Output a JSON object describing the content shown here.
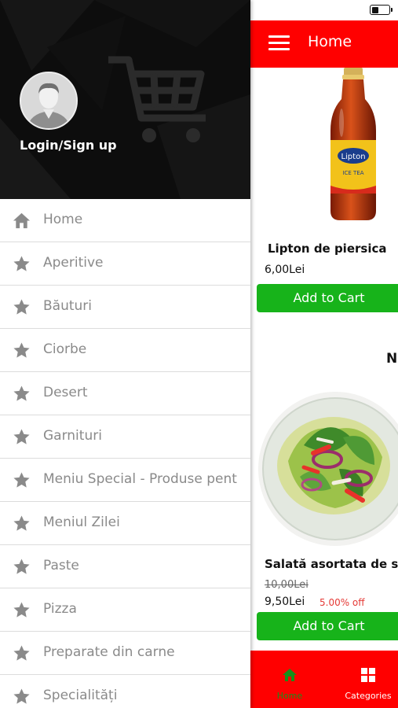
{
  "status_bar": {
    "battery_level": 0.4
  },
  "header": {
    "title": "Home"
  },
  "products": [
    {
      "name": "Lipton de piersica",
      "price": "6,00Lei",
      "button_label": "Add to Cart",
      "bottle_label": "Lipton",
      "bottle_sub": "ICE TEA"
    },
    {
      "section_initial": "N",
      "name": "Salată asortata de se",
      "old_price": "10,00Lei",
      "price": "9,50Lei",
      "discount": "5.00% off",
      "button_label": "Add to Cart"
    }
  ],
  "bottom_nav": {
    "items": [
      {
        "label": "Home",
        "icon": "home-icon",
        "active": true
      },
      {
        "label": "Categories",
        "icon": "grid-icon",
        "active": false
      }
    ]
  },
  "drawer": {
    "login_label": "Login/Sign up",
    "items": [
      {
        "label": "Home",
        "icon": "home-icon"
      },
      {
        "label": "Aperitive",
        "icon": "star-icon"
      },
      {
        "label": "Băuturi",
        "icon": "star-icon"
      },
      {
        "label": "Ciorbe",
        "icon": "star-icon"
      },
      {
        "label": "Desert",
        "icon": "star-icon"
      },
      {
        "label": "Garnituri",
        "icon": "star-icon"
      },
      {
        "label": "Meniu Special  - Produse pent",
        "icon": "star-icon"
      },
      {
        "label": "Meniul Zilei",
        "icon": "star-icon"
      },
      {
        "label": "Paste",
        "icon": "star-icon"
      },
      {
        "label": "Pizza",
        "icon": "star-icon"
      },
      {
        "label": "Preparate din carne",
        "icon": "star-icon"
      },
      {
        "label": "Specialități",
        "icon": "star-icon"
      }
    ]
  },
  "colors": {
    "primary_red": "#ff0000",
    "cart_green": "#17b31a",
    "discount_red": "#e53935",
    "active_nav_green": "#178f1a",
    "drawer_text_gray": "#8a8a8a"
  }
}
